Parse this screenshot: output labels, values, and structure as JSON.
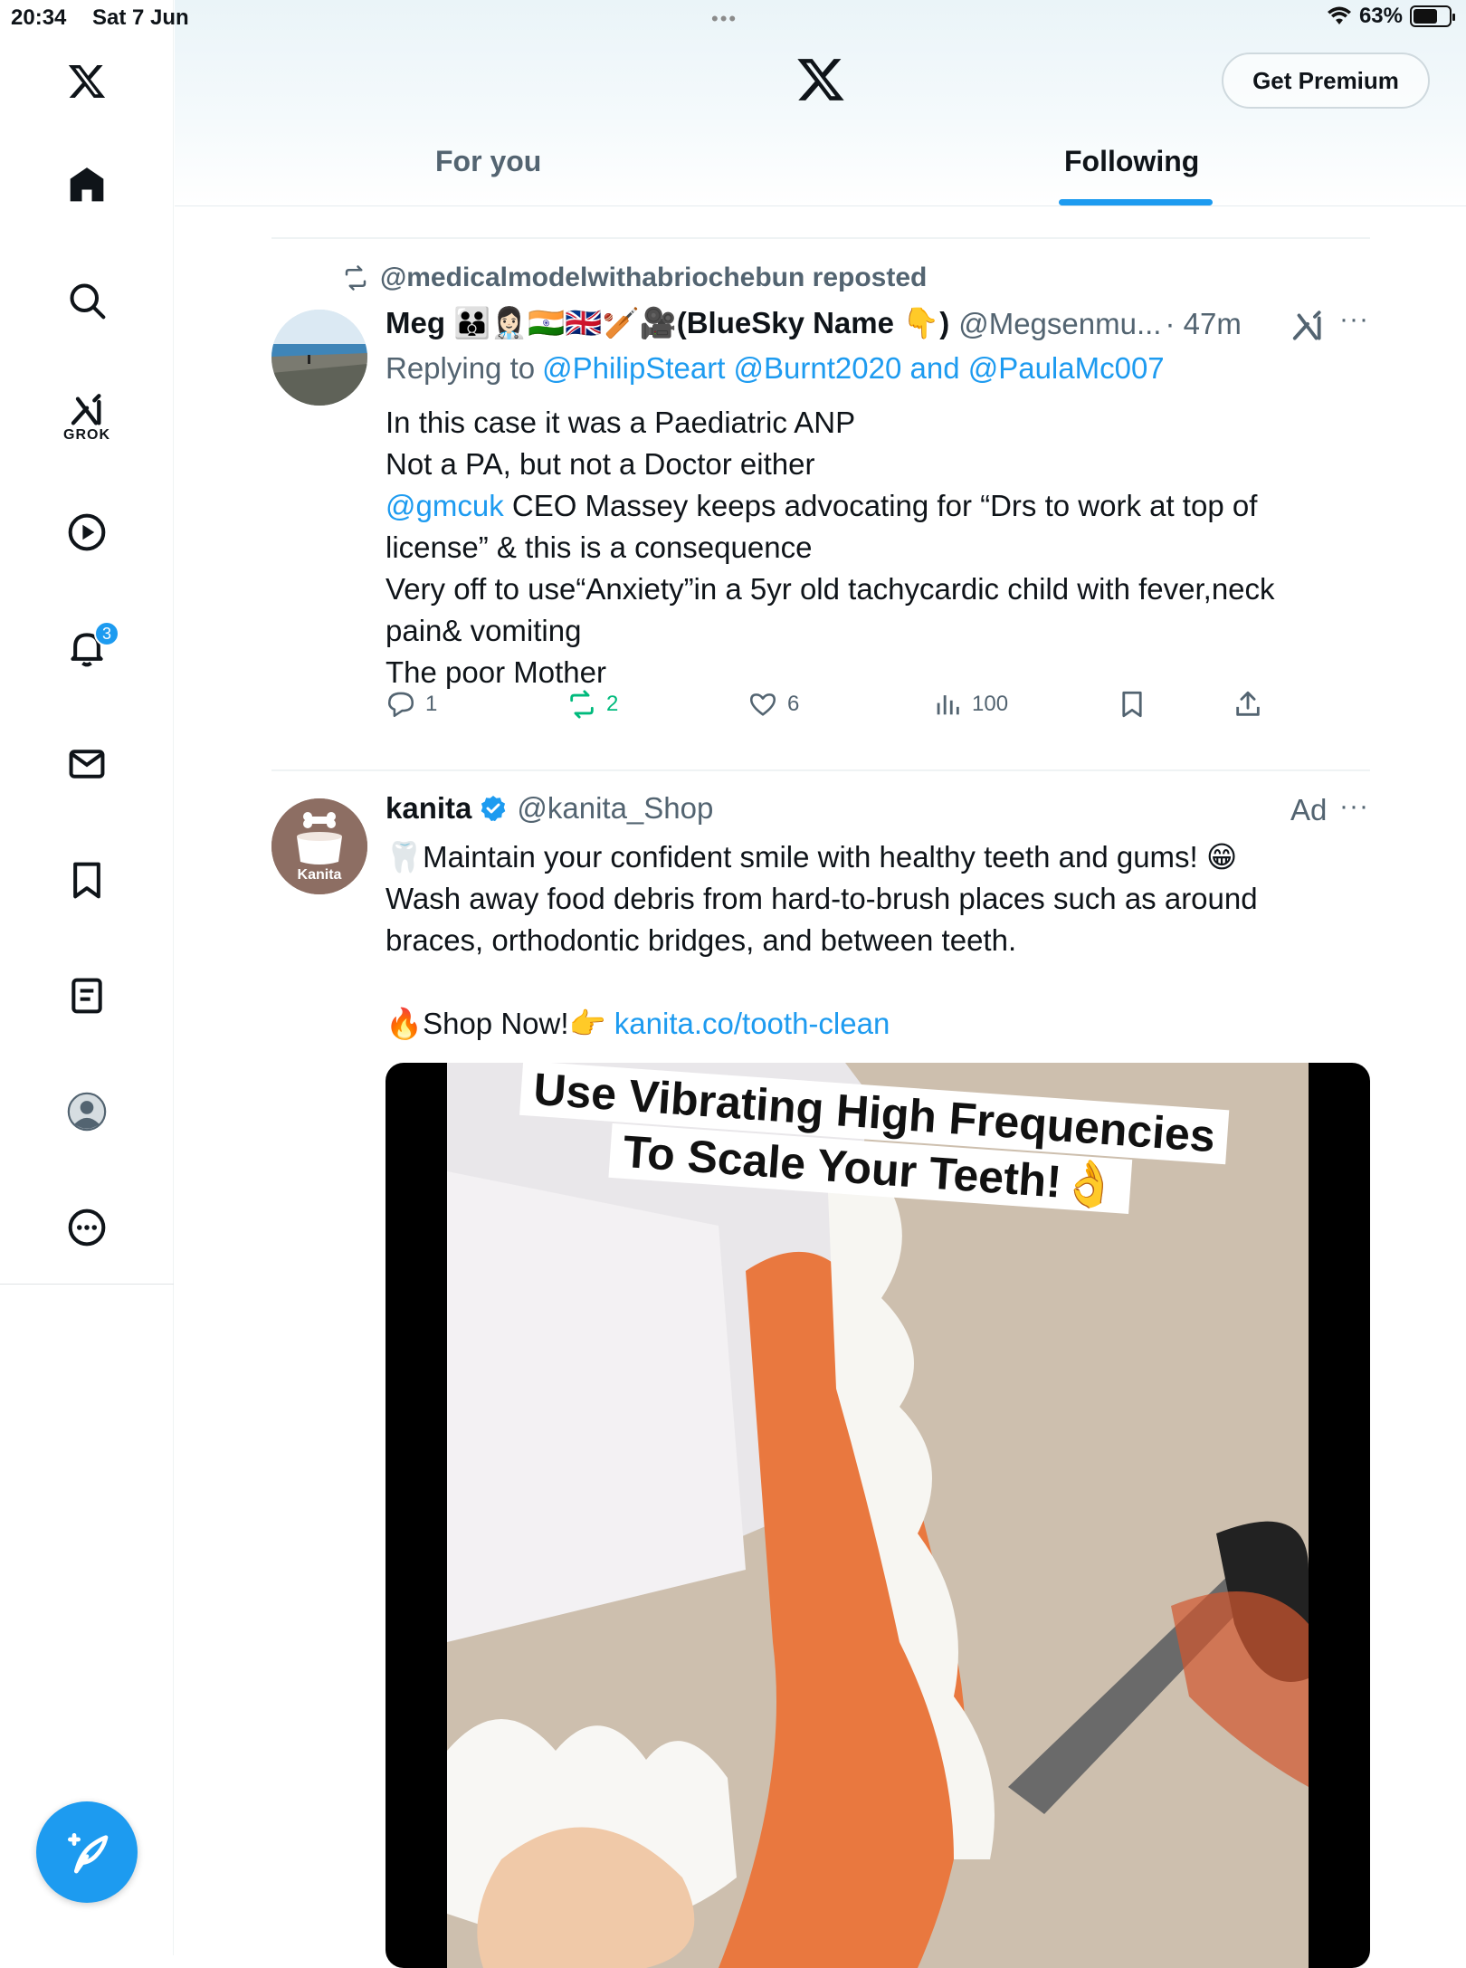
{
  "status_bar": {
    "time": "20:34",
    "date": "Sat 7 Jun",
    "battery": "63%"
  },
  "sidebar": {
    "grok_label": "GROK",
    "notifications_count": "3"
  },
  "header": {
    "premium_label": "Get Premium",
    "tabs": [
      {
        "label": "For you"
      },
      {
        "label": "Following"
      }
    ]
  },
  "post1": {
    "repost_text": "@medicalmodelwithabriochebun reposted",
    "name": "Meg 🧑‍🧑‍🧒👩🏻‍⚕️🇮🇳🇬🇧🏏🎥(BlueSky Name 👇)",
    "handle": "@Megsenmu...",
    "time": "· 47m",
    "replying_prefix": "Replying to",
    "replying_to": "@PhilipSteart @Burnt2020 and @PaulaMc007",
    "lines": [
      "In this case it was a Paediatric ANP",
      "Not a PA, but not a Doctor either"
    ],
    "mention": "@gmcuk",
    "line3_rest": " CEO Massey keeps advocating for “Drs to work at top of",
    "lines_after": [
      "license” & this is a consequence",
      "Very off to use“Anxiety”in a 5yr old tachycardic child with fever,neck",
      "pain& vomiting",
      "The poor Mother"
    ],
    "reply_count": "1",
    "repost_count": "2",
    "like_count": "6",
    "view_count": "100"
  },
  "post2": {
    "name": "kanita",
    "handle": "@kanita_Shop",
    "ad_label": "Ad",
    "avatar_label": "Kanita",
    "line1": "🦷Maintain your confident smile with healthy teeth and gums! 😁",
    "line2": "Wash away food debris from hard-to-brush places such as around",
    "line3": "braces, orthodontic bridges, and between teeth.",
    "cta_prefix": "🔥Shop Now!👉",
    "cta_link": "kanita.co/tooth-clean",
    "media_caption_line1": "Use Vibrating High Frequencies",
    "media_caption_line2": "To Scale Your Teeth!👌"
  },
  "colors": {
    "accent": "#1d9bf0",
    "repost_green": "#00ba7c",
    "secondary_text": "#536471"
  }
}
